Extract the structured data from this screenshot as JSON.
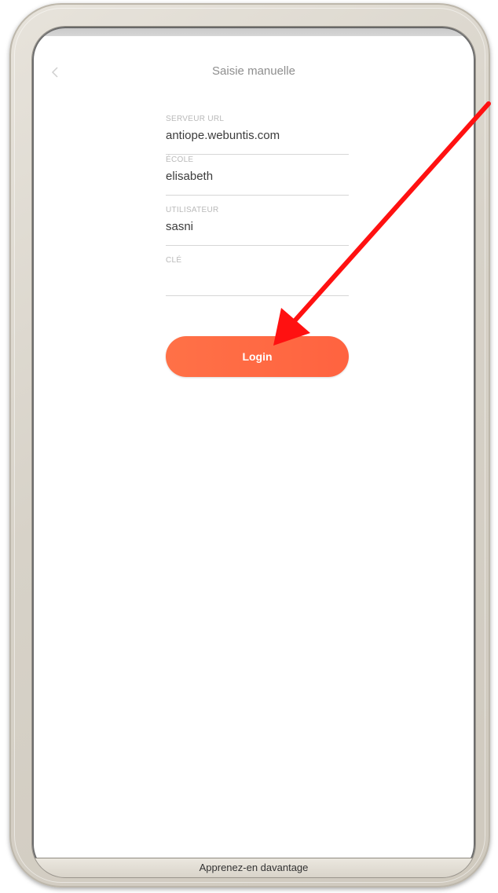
{
  "screen": {
    "title": "Saisie manuelle",
    "back_icon": "chevron-left-icon"
  },
  "form": {
    "fields": [
      {
        "label": "SERVEUR URL",
        "value": "antiope.webuntis.com"
      },
      {
        "label": "ÉCOLE",
        "value": "elisabeth"
      },
      {
        "label": "UTILISATEUR",
        "value": "sasni"
      },
      {
        "label": "CLÉ",
        "value": ""
      }
    ],
    "login_label": "Login"
  },
  "footer": {
    "link_label": "Apprenez-en davantage"
  },
  "colors": {
    "accent": "#ff6b44",
    "annotation_arrow": "#ff0000",
    "frame": "#d9d4ca"
  }
}
